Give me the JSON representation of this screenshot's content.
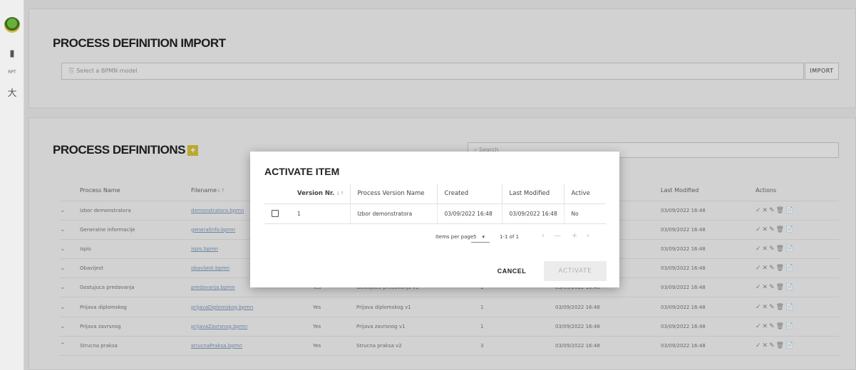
{
  "sidebar": {
    "items": [
      {
        "icon": "document-icon"
      },
      {
        "label": "RPT"
      },
      {
        "icon": "person-icon"
      }
    ]
  },
  "import_section": {
    "title": "PROCESS DEFINITION IMPORT",
    "file_placeholder": "Select a BPMN model",
    "import_label": "IMPORT"
  },
  "definitions_section": {
    "title": "PROCESS DEFINITIONS",
    "add_glyph": "+",
    "search_placeholder": "Search",
    "columns": [
      "",
      "Process Name",
      "Filename",
      "",
      "",
      "",
      "Last Modified",
      "Actions"
    ],
    "rows": [
      {
        "expand": "⌄",
        "name": "Izbor demonstratora",
        "file": "demonstratora.bpmn",
        "active": "",
        "version_name": "",
        "version": "",
        "created": "",
        "modified": "03/09/2022 16:48"
      },
      {
        "expand": "⌄",
        "name": "Generalne informacije",
        "file": "generalInfo.bpmn",
        "active": "",
        "version_name": "",
        "version": "",
        "created": "",
        "modified": "03/09/2022 16:48"
      },
      {
        "expand": "⌄",
        "name": "Ispis",
        "file": "ispis.bpmn",
        "active": "",
        "version_name": "",
        "version": "",
        "created": "",
        "modified": "03/09/2022 16:48"
      },
      {
        "expand": "⌄",
        "name": "Obavijest",
        "file": "obavijest.bpmn",
        "active": "",
        "version_name": "",
        "version": "",
        "created": "",
        "modified": "03/09/2022 16:48"
      },
      {
        "expand": "⌄",
        "name": "Gostujuca predavanja",
        "file": "predavanja.bpmn",
        "active": "Yes",
        "version_name": "Gostujuca predavanja v1",
        "version": "1",
        "created": "03/09/2022 16:48",
        "modified": "03/09/2022 16:48"
      },
      {
        "expand": "⌄",
        "name": "Prijava diplomskog",
        "file": "prijavaDiplomskog.bpmn",
        "active": "Yes",
        "version_name": "Prijava diplomskog v1",
        "version": "1",
        "created": "03/09/2022 16:48",
        "modified": "03/09/2022 16:48"
      },
      {
        "expand": "⌄",
        "name": "Prijava zavrsnog",
        "file": "prijavaZavrsnog.bpmn",
        "active": "Yes",
        "version_name": "Prijava zavrsnog v1",
        "version": "1",
        "created": "03/09/2022 16:48",
        "modified": "03/09/2022 16:48"
      },
      {
        "expand": "⌃",
        "name": "Strucna praksa",
        "file": "strucnaPraksa.bpmn",
        "active": "Yes",
        "version_name": "Strucna praksa v2",
        "version": "3",
        "created": "03/09/2022 16:48",
        "modified": "03/09/2022 16:48"
      }
    ],
    "action_glyphs": [
      "✓",
      "✕",
      "✎",
      "🗑",
      "📄"
    ]
  },
  "dialog": {
    "title": "ACTIVATE ITEM",
    "columns": {
      "version_nr": "Version Nr.",
      "process_version_name": "Process Version Name",
      "created": "Created",
      "last_modified": "Last Modified",
      "active": "Active"
    },
    "rows": [
      {
        "version_nr": "1",
        "process_version_name": "Izbor demonstratora",
        "created": "03/09/2022 16:48",
        "last_modified": "03/09/2022 16:48",
        "active": "No"
      }
    ],
    "paginator": {
      "items_per_page_label": "Items per page",
      "page_size": "5",
      "range_label": "1-1 of 1"
    },
    "cancel_label": "CANCEL",
    "activate_label": "ACTIVATE"
  }
}
